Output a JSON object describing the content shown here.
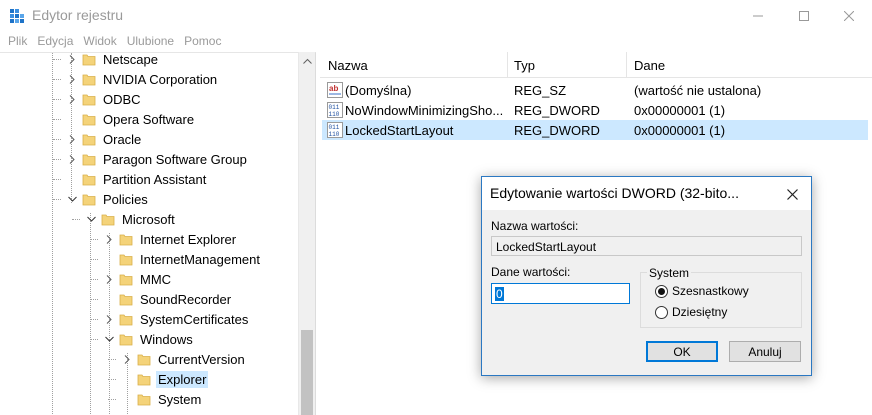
{
  "window": {
    "title": "Edytor rejestru",
    "menu": [
      "Plik",
      "Edycja",
      "Widok",
      "Ulubione",
      "Pomoc"
    ]
  },
  "tree": {
    "items": [
      {
        "label": "Netscape",
        "level": 1,
        "expander": "collapsed"
      },
      {
        "label": "NVIDIA Corporation",
        "level": 1,
        "expander": "collapsed"
      },
      {
        "label": "ODBC",
        "level": 1,
        "expander": "collapsed"
      },
      {
        "label": "Opera Software",
        "level": 1,
        "expander": "none"
      },
      {
        "label": "Oracle",
        "level": 1,
        "expander": "collapsed"
      },
      {
        "label": "Paragon Software Group",
        "level": 1,
        "expander": "collapsed"
      },
      {
        "label": "Partition Assistant",
        "level": 1,
        "expander": "none"
      },
      {
        "label": "Policies",
        "level": 1,
        "expander": "expanded"
      },
      {
        "label": "Microsoft",
        "level": 2,
        "expander": "expanded"
      },
      {
        "label": "Internet Explorer",
        "level": 3,
        "expander": "collapsed"
      },
      {
        "label": "InternetManagement",
        "level": 3,
        "expander": "none"
      },
      {
        "label": "MMC",
        "level": 3,
        "expander": "collapsed"
      },
      {
        "label": "SoundRecorder",
        "level": 3,
        "expander": "none"
      },
      {
        "label": "SystemCertificates",
        "level": 3,
        "expander": "collapsed"
      },
      {
        "label": "Windows",
        "level": 3,
        "expander": "expanded"
      },
      {
        "label": "CurrentVersion",
        "level": 4,
        "expander": "collapsed"
      },
      {
        "label": "Explorer",
        "level": 4,
        "expander": "none",
        "selected": true
      },
      {
        "label": "System",
        "level": 4,
        "expander": "none"
      }
    ]
  },
  "list": {
    "columns": [
      "Nazwa",
      "Typ",
      "Dane"
    ],
    "rows": [
      {
        "icon": "string",
        "name": "(Domyślna)",
        "type": "REG_SZ",
        "data": "(wartość nie ustalona)"
      },
      {
        "icon": "binary",
        "name": "NoWindowMinimizingSho...",
        "type": "REG_DWORD",
        "data": "0x00000001 (1)"
      },
      {
        "icon": "binary",
        "name": "LockedStartLayout",
        "type": "REG_DWORD",
        "data": "0x00000001 (1)",
        "selected": true
      }
    ]
  },
  "dialog": {
    "title": "Edytowanie wartości DWORD (32-bito...",
    "name_label": "Nazwa wartości:",
    "name_value": "LockedStartLayout",
    "data_label": "Dane wartości:",
    "data_value": "0",
    "system_label": "System",
    "radio_hex": "Szesnastkowy",
    "radio_dec": "Dziesiętny",
    "selected_base": "hex",
    "ok_label": "OK",
    "cancel_label": "Anuluj"
  },
  "colors": {
    "accent": "#0078d7",
    "selection": "#cce8ff",
    "folder": "#f4d37a"
  }
}
